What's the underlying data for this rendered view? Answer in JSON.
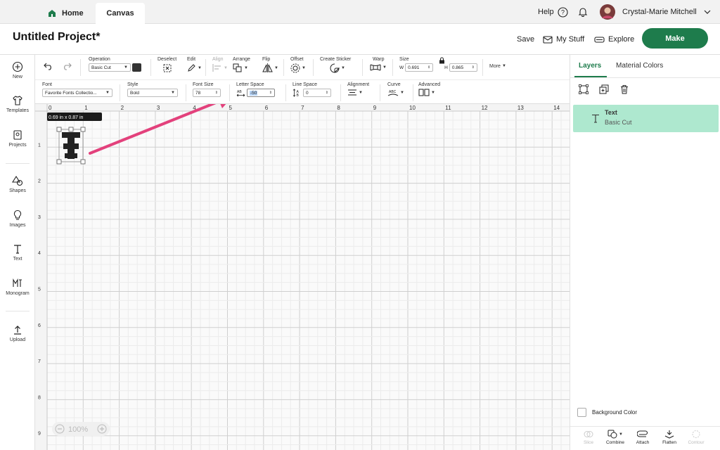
{
  "tabs": {
    "home": "Home",
    "canvas": "Canvas"
  },
  "top_right": {
    "help": "Help",
    "user_name": "Crystal-Marie Mitchell"
  },
  "project": {
    "title": "Untitled Project*",
    "save": "Save",
    "my_stuff": "My Stuff",
    "explore": "Explore",
    "make": "Make"
  },
  "sidebar": [
    "New",
    "Templates",
    "Projects",
    "Shapes",
    "Images",
    "Text",
    "Monogram",
    "Upload"
  ],
  "toolbar1": {
    "operation": {
      "label": "Operation",
      "value": "Basic Cut"
    },
    "deselect": "Deselect",
    "edit": "Edit",
    "align": "Align",
    "arrange": "Arrange",
    "flip": "Flip",
    "offset": "Offset",
    "create_sticker": "Create Sticker",
    "warp": "Warp",
    "size": {
      "label": "Size",
      "w_label": "W",
      "w_value": "0.691",
      "h_label": "H",
      "h_value": "0.865"
    },
    "more": "More"
  },
  "toolbar2": {
    "font": {
      "label": "Font",
      "value": "Favorite Fonts Collectio..."
    },
    "style": {
      "label": "Style",
      "value": "Bold"
    },
    "font_size": {
      "label": "Font Size",
      "value": "78"
    },
    "letter_space": {
      "label": "Letter Space",
      "value": "-50"
    },
    "line_space": {
      "label": "Line Space",
      "value": "0"
    },
    "alignment": "Alignment",
    "curve": "Curve",
    "advanced": "Advanced"
  },
  "canvas": {
    "ruler_h": [
      "0",
      "1",
      "2",
      "3",
      "4",
      "5",
      "6",
      "7",
      "8",
      "9",
      "10",
      "11",
      "12",
      "13",
      "14"
    ],
    "ruler_v": [
      "1",
      "2",
      "3",
      "4",
      "5",
      "6",
      "7",
      "8",
      "9"
    ],
    "dimension_tooltip": "0.69  in x 0.87  in",
    "zoom": "100%"
  },
  "right_panel": {
    "tabs": {
      "layers": "Layers",
      "material_colors": "Material Colors"
    },
    "layer": {
      "name": "Text",
      "operation": "Basic Cut"
    },
    "background_color": "Background Color",
    "actions": [
      "Slice",
      "Combine",
      "Attach",
      "Flatten",
      "Contour"
    ]
  },
  "colors": {
    "accent": "#1e7c4c",
    "layer_highlight": "#aee8cf",
    "annotation_arrow": "#e3417c",
    "swatch": "#333333"
  }
}
